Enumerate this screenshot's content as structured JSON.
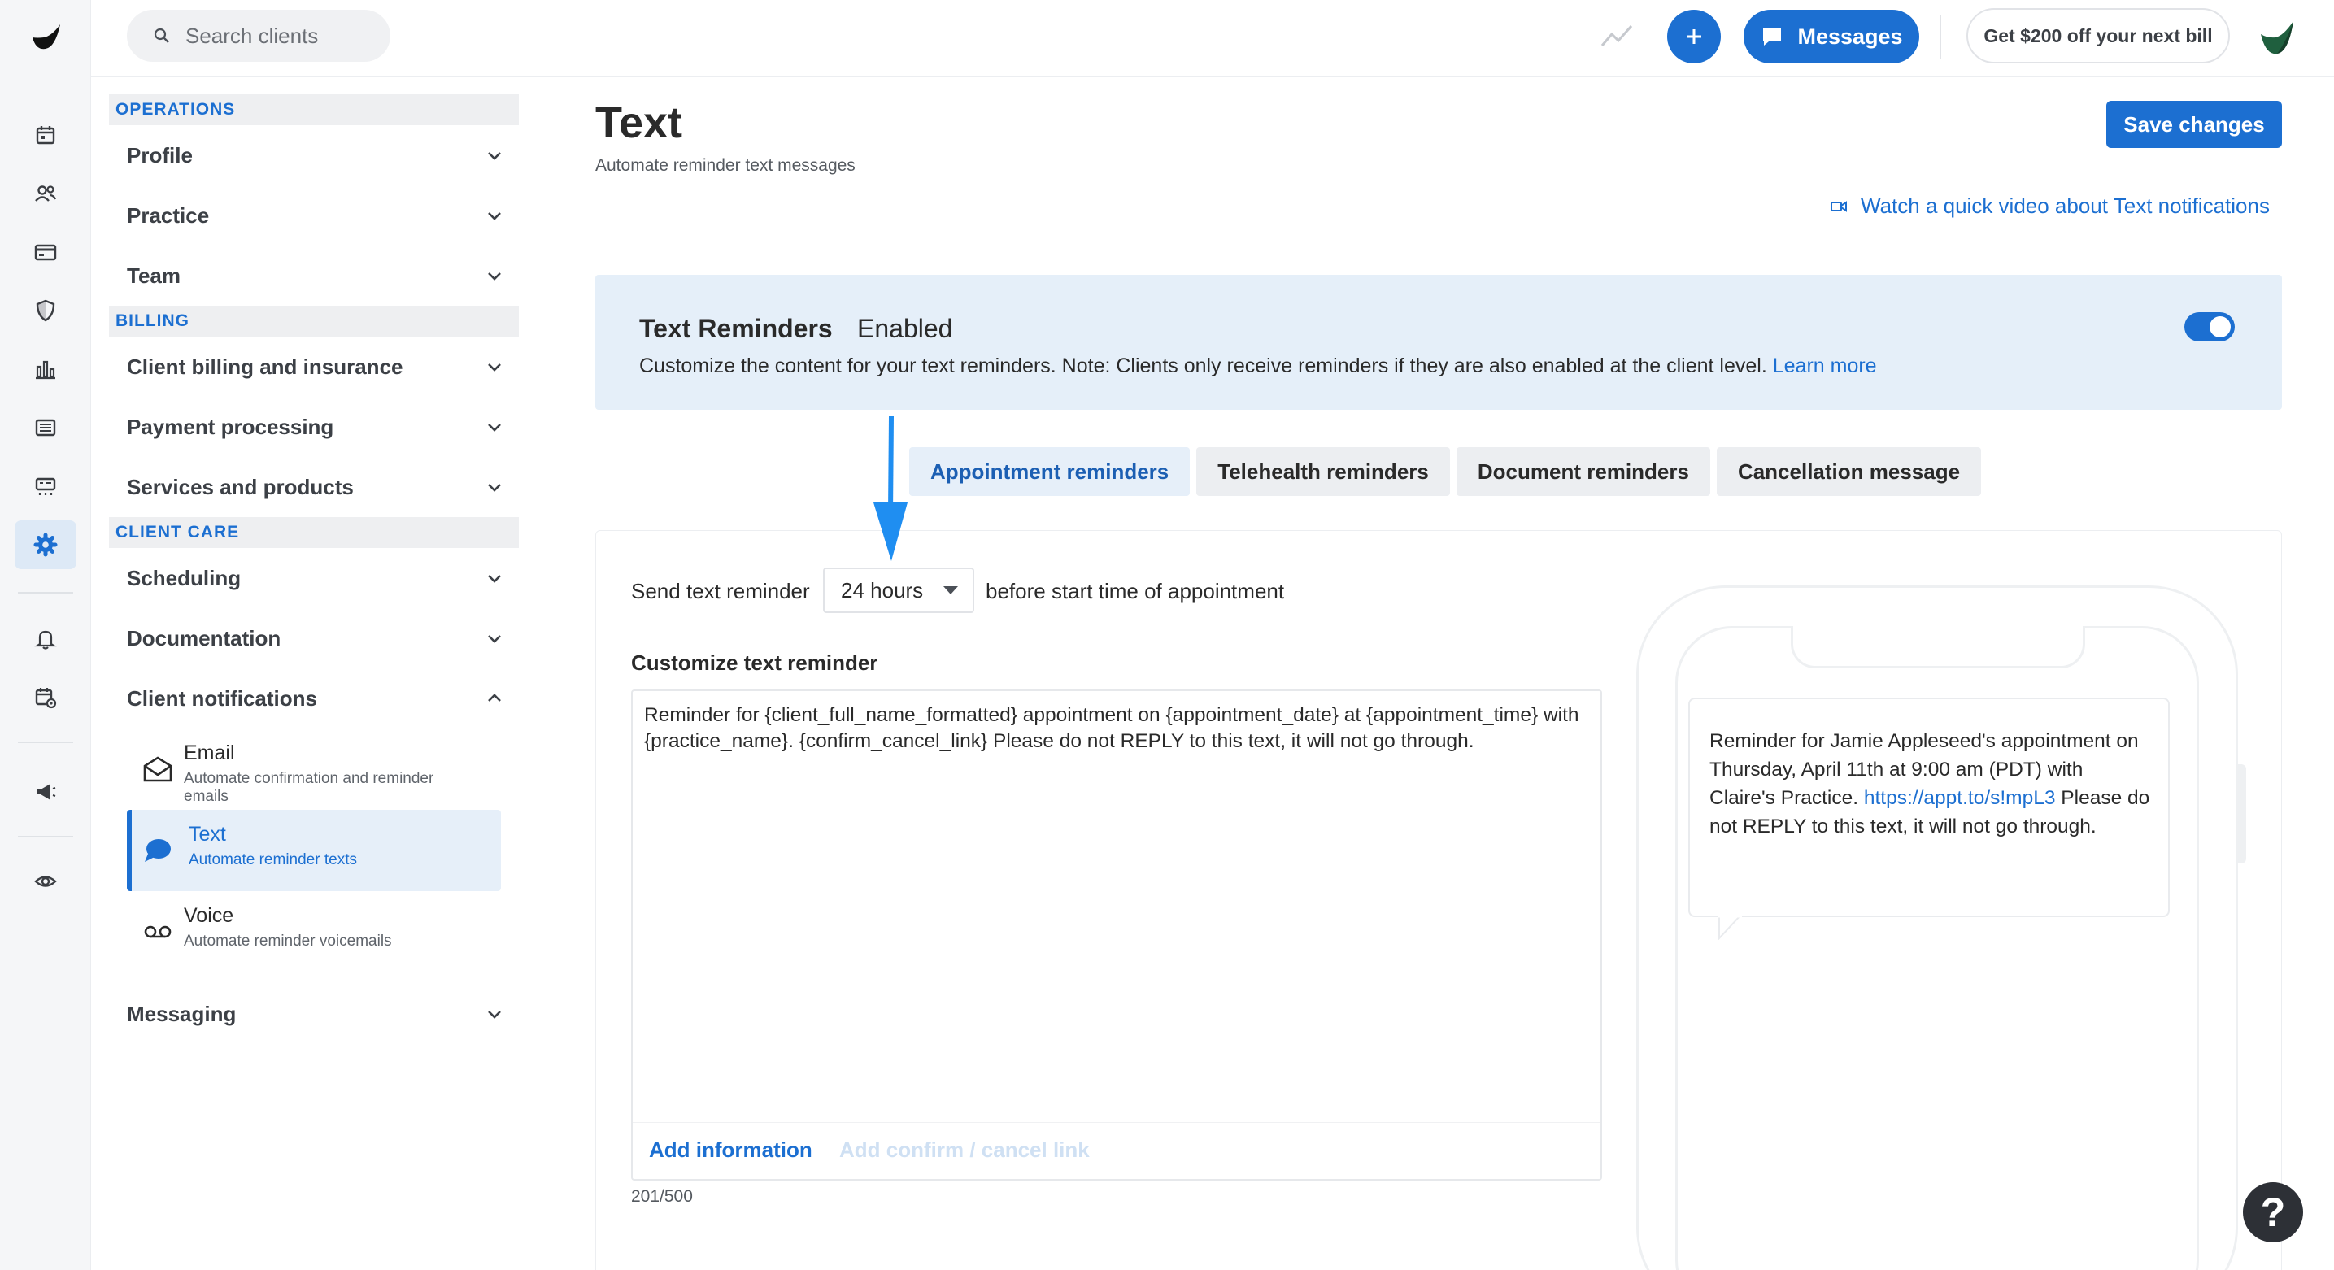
{
  "search": {
    "placeholder": "Search clients"
  },
  "header": {
    "messages_label": "Messages",
    "promo_label": "Get $200 off your next bill"
  },
  "icons": {
    "rail": [
      "calendar-icon",
      "clients-icon",
      "billing-card-icon",
      "insurance-shield-icon",
      "analytics-bars-icon",
      "documents-list-icon",
      "marketplace-store-icon",
      "settings-gear-icon",
      "notifications-bell-icon",
      "calendar-settings-icon",
      "megaphone-icon",
      "eye-icon"
    ]
  },
  "colors": {
    "accent": "#1c6fd1",
    "banner_bg": "#e5eff9",
    "rail_bg": "#f5f6f8"
  },
  "sidebar": {
    "sections": [
      {
        "title": "OPERATIONS",
        "items": [
          "Profile",
          "Practice",
          "Team"
        ]
      },
      {
        "title": "BILLING",
        "items": [
          "Client billing and insurance",
          "Payment processing",
          "Services and products"
        ]
      },
      {
        "title": "CLIENT CARE",
        "items": [
          "Scheduling",
          "Documentation",
          "Client notifications",
          "Messaging"
        ]
      }
    ],
    "notifications_sub": [
      {
        "title": "Email",
        "desc": "Automate confirmation and reminder emails"
      },
      {
        "title": "Text",
        "desc": "Automate reminder texts"
      },
      {
        "title": "Voice",
        "desc": "Automate reminder voicemails"
      }
    ]
  },
  "main": {
    "title": "Text",
    "subtitle": "Automate reminder text messages",
    "save_label": "Save changes",
    "video_link": "Watch a quick video about Text notifications",
    "banner": {
      "title": "Text Reminders",
      "status": "Enabled",
      "desc": "Customize the content for your text reminders. Note: Clients only receive reminders if they are also enabled at the client level.",
      "learn_more": "Learn more",
      "enabled": true
    },
    "tabs": [
      "Appointment reminders",
      "Telehealth reminders",
      "Document reminders",
      "Cancellation message"
    ],
    "active_tab": "Appointment reminders",
    "send_label": "Send text reminder",
    "hours_value": "24 hours",
    "before_label": "before start time of appointment",
    "customize_label": "Customize text reminder",
    "template_text": "Reminder for {client_full_name_formatted} appointment on {appointment_date} at {appointment_time} with {practice_name}. {confirm_cancel_link} Please do not REPLY to this text, it will not go through.",
    "add_information": "Add information",
    "add_confirm_link": "Add confirm / cancel link",
    "char_count": "201/500",
    "preview": {
      "text_before_link": "Reminder for Jamie Appleseed's appointment on Thursday, April 11th at 9:00 am (PDT) with Claire's Practice.",
      "link": "https://appt.to/s!mpL3",
      "text_after_link": "Please do not REPLY to this text, it will not go through."
    }
  },
  "help_label": "?"
}
